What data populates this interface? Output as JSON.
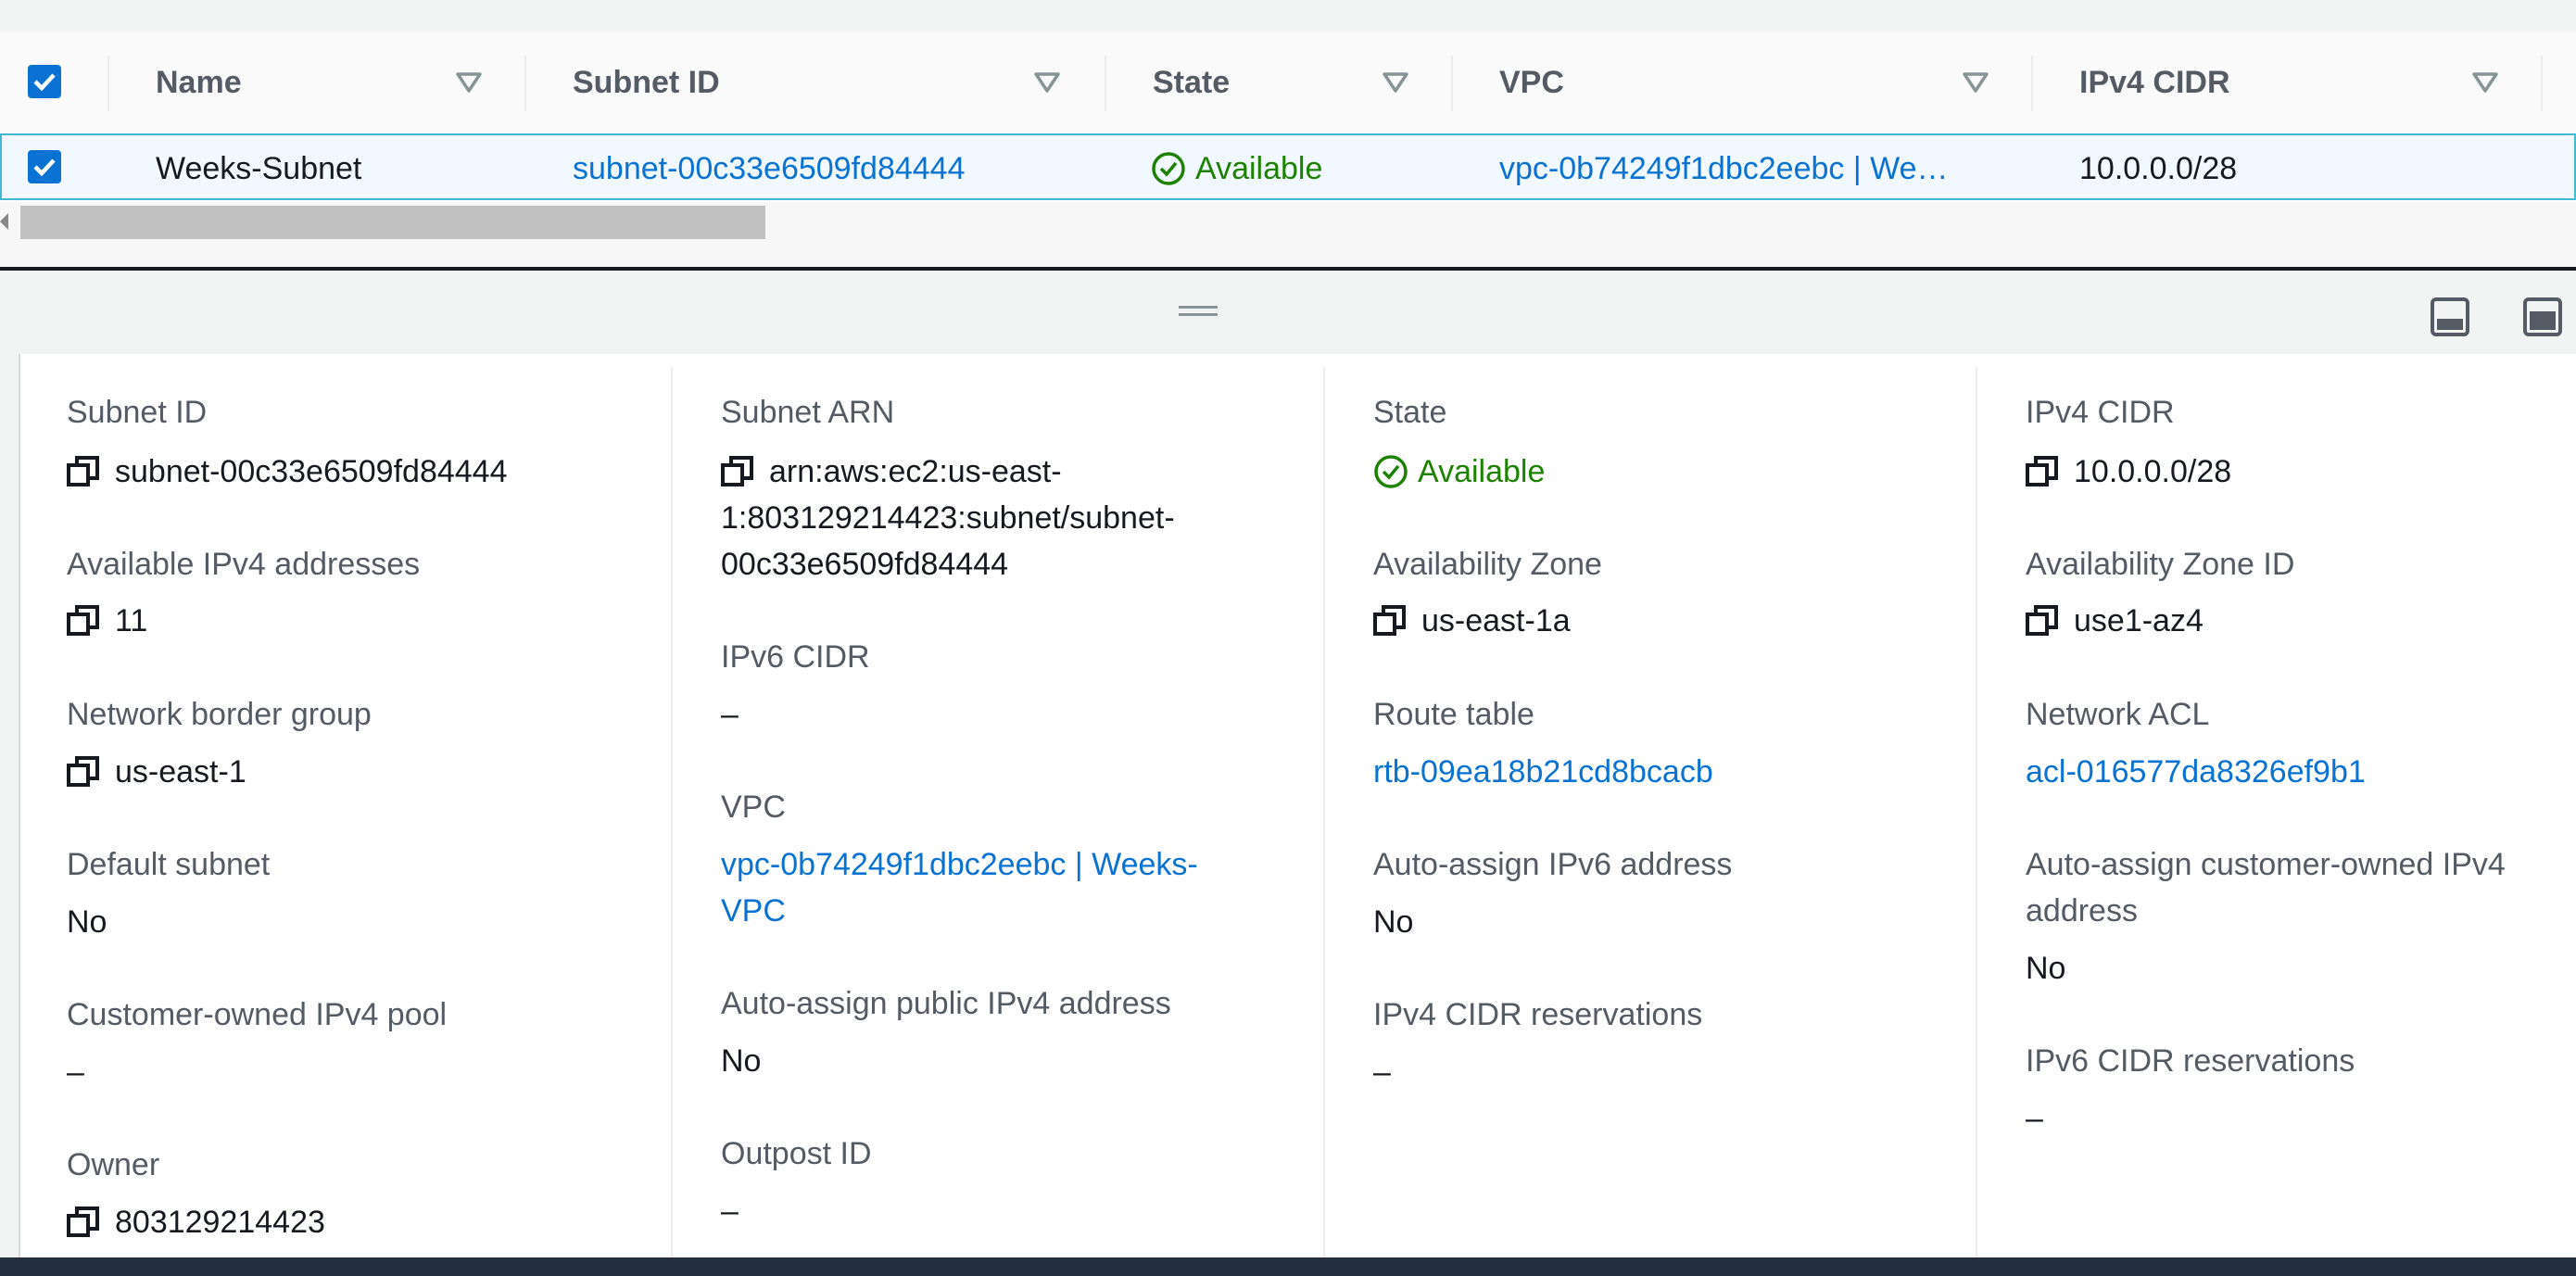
{
  "table": {
    "columns": [
      {
        "label": "Name"
      },
      {
        "label": "Subnet ID"
      },
      {
        "label": "State"
      },
      {
        "label": "VPC"
      },
      {
        "label": "IPv4 CIDR"
      }
    ],
    "row": {
      "name": "Weeks-Subnet",
      "subnet_id": "subnet-00c33e6509fd84444",
      "state": "Available",
      "vpc": "vpc-0b74249f1dbc2eebc | We…",
      "ipv4_cidr": "10.0.0.0/28"
    }
  },
  "details": {
    "col1": [
      {
        "label": "Subnet ID",
        "value": "subnet-00c33e6509fd84444"
      },
      {
        "label": "Available IPv4 addresses",
        "value": "11"
      },
      {
        "label": "Network border group",
        "value": "us-east-1"
      },
      {
        "label": "Default subnet",
        "value": "No"
      },
      {
        "label": "Customer-owned IPv4 pool",
        "value": "–"
      },
      {
        "label": "Owner",
        "value": "803129214423"
      }
    ],
    "col2": [
      {
        "label": "Subnet ARN",
        "value_lines": [
          "arn:aws:ec2:us-east-",
          "1:803129214423:subnet/subnet-",
          "00c33e6509fd84444"
        ]
      },
      {
        "label": "IPv6 CIDR",
        "value": "–"
      },
      {
        "label": "VPC",
        "value_lines": [
          "vpc-0b74249f1dbc2eebc | Weeks-",
          "VPC"
        ]
      },
      {
        "label": "Auto-assign public IPv4 address",
        "value": "No"
      },
      {
        "label": "Outpost ID",
        "value": "–"
      }
    ],
    "col3": [
      {
        "label": "State",
        "value": "Available"
      },
      {
        "label": "Availability Zone",
        "value": "us-east-1a"
      },
      {
        "label": "Route table",
        "value": "rtb-09ea18b21cd8bcacb"
      },
      {
        "label": "Auto-assign IPv6 address",
        "value": "No"
      },
      {
        "label": "IPv4 CIDR reservations",
        "value": "–"
      }
    ],
    "col4": [
      {
        "label": "IPv4 CIDR",
        "value": "10.0.0.0/28"
      },
      {
        "label": "Availability Zone ID",
        "value": "use1-az4"
      },
      {
        "label": "Network ACL",
        "value": "acl-016577da8326ef9b1"
      },
      {
        "label_lines": [
          "Auto-assign customer-owned IPv4",
          "address"
        ],
        "value": "No"
      },
      {
        "label": "IPv6 CIDR reservations",
        "value": "–"
      }
    ]
  },
  "colors": {
    "link": "#0972d3",
    "success": "#1d8102",
    "accent": "#0972d3"
  },
  "icons": [
    "checkbox-checked-icon",
    "sort-icon",
    "status-available-icon",
    "copy-icon",
    "drag-handle-icon",
    "panel-bottom-icon",
    "panel-side-icon"
  ]
}
